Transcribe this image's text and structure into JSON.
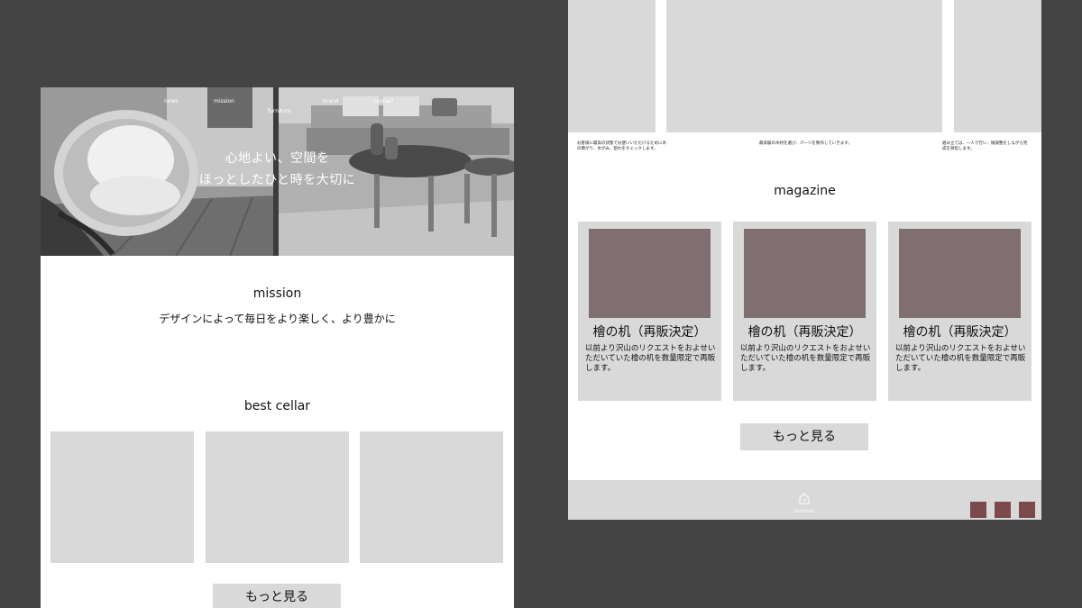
{
  "left_page": {
    "hero": {
      "nav": [
        "news",
        "mission",
        "furniture",
        "brand",
        "contact"
      ],
      "headline_line1": "心地よい、空間を",
      "headline_line2": "ほっとしたひと時を大切に"
    },
    "mission": {
      "title": "mission",
      "subtitle": "デザインによって毎日をより楽しく、より豊かに"
    },
    "best_cellar": {
      "title": "best cellar",
      "more_label": "もっと見る"
    }
  },
  "right_page": {
    "notes": [
      "お客様に最高の状態でお使いいただけるために木の節がり、ゆがみ、割れをチェックします。",
      "最高級の木材を選び、パーツを製作していきます。",
      "組み立ては、一人で行い、微調整をしながら完成を目指します。"
    ],
    "magazine": {
      "title": "magazine",
      "cards": [
        {
          "title": "檜の机（再販決定）",
          "desc": "以前より沢山のリクエストをおよせいただいていた檜の机を数量限定で再販します。"
        },
        {
          "title": "檜の机（再販決定）",
          "desc": "以前より沢山のリクエストをおよせいただいていた檜の机を数量限定で再販します。"
        },
        {
          "title": "檜の机（再販決定）",
          "desc": "以前より沢山のリクエストをおよせいただいていた檜の机を数量限定で再販します。"
        }
      ],
      "more_label": "もっと見る"
    },
    "footer": {
      "logo_text": "furniture",
      "logo_icon": "house-icon",
      "social_icons": [
        "social-square-1",
        "social-square-2",
        "social-square-3"
      ]
    }
  },
  "colors": {
    "background": "#444444",
    "placeholder": "#d9d9d9",
    "card_image": "#806f70",
    "social_square": "#7a4a4c"
  }
}
